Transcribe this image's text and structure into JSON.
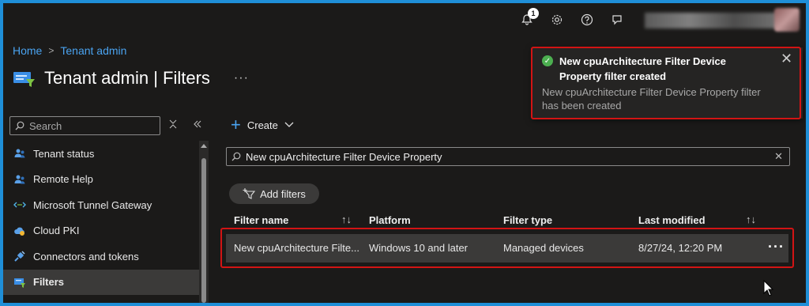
{
  "topbar": {
    "notification_count": "1",
    "icons": [
      "bell-icon",
      "gear-icon",
      "help-icon",
      "feedback-icon"
    ]
  },
  "breadcrumb": {
    "home": "Home",
    "separator": ">",
    "current": "Tenant admin"
  },
  "page": {
    "title": "Tenant admin | Filters",
    "more": "···"
  },
  "sidebar": {
    "search_placeholder": "Search",
    "items": [
      {
        "label": "Tenant status",
        "icon": "people-icon"
      },
      {
        "label": "Remote Help",
        "icon": "people-icon"
      },
      {
        "label": "Microsoft Tunnel Gateway",
        "icon": "tunnel-icon"
      },
      {
        "label": "Cloud PKI",
        "icon": "cloud-icon"
      },
      {
        "label": "Connectors and tokens",
        "icon": "plug-icon"
      },
      {
        "label": "Filters",
        "icon": "filter-icon",
        "active": true
      }
    ]
  },
  "toolbar": {
    "create_label": "Create"
  },
  "filter_search": {
    "value": "New cpuArchitecture Filter Device Property"
  },
  "add_filters_label": "Add filters",
  "table": {
    "columns": [
      "Filter name",
      "Platform",
      "Filter type",
      "Last modified"
    ],
    "rows": [
      {
        "name": "New cpuArchitecture Filte...",
        "platform": "Windows 10 and later",
        "type": "Managed devices",
        "modified": "8/27/24, 12:20 PM",
        "more": "···"
      }
    ]
  },
  "toast": {
    "title": "New cpuArchitecture Filter Device Property filter created",
    "body": "New cpuArchitecture Filter Device Property filter has been created"
  },
  "colors": {
    "accent": "#4aa3f0",
    "highlight_border": "#d21414",
    "success": "#4caf50",
    "background": "#1b1a19"
  }
}
